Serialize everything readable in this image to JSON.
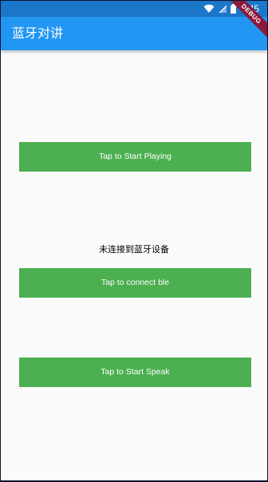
{
  "status_bar": {
    "time": "4:45",
    "icons": [
      "wifi-icon",
      "signal-icon",
      "battery-icon"
    ]
  },
  "app_bar": {
    "title": "蓝牙对讲"
  },
  "debug_banner": {
    "label": "DEBUG"
  },
  "main": {
    "play_button_label": "Tap to Start Playing",
    "connection_status": "未连接到蓝牙设备",
    "connect_button_label": "Tap to connect ble",
    "speak_button_label": "Tap to Start Speak"
  },
  "colors": {
    "app_bar": "#2196f3",
    "status_bar": "#1a77c9",
    "button": "#4caf50",
    "background": "#fafafa",
    "debug_ribbon": "#8b1a3a"
  }
}
